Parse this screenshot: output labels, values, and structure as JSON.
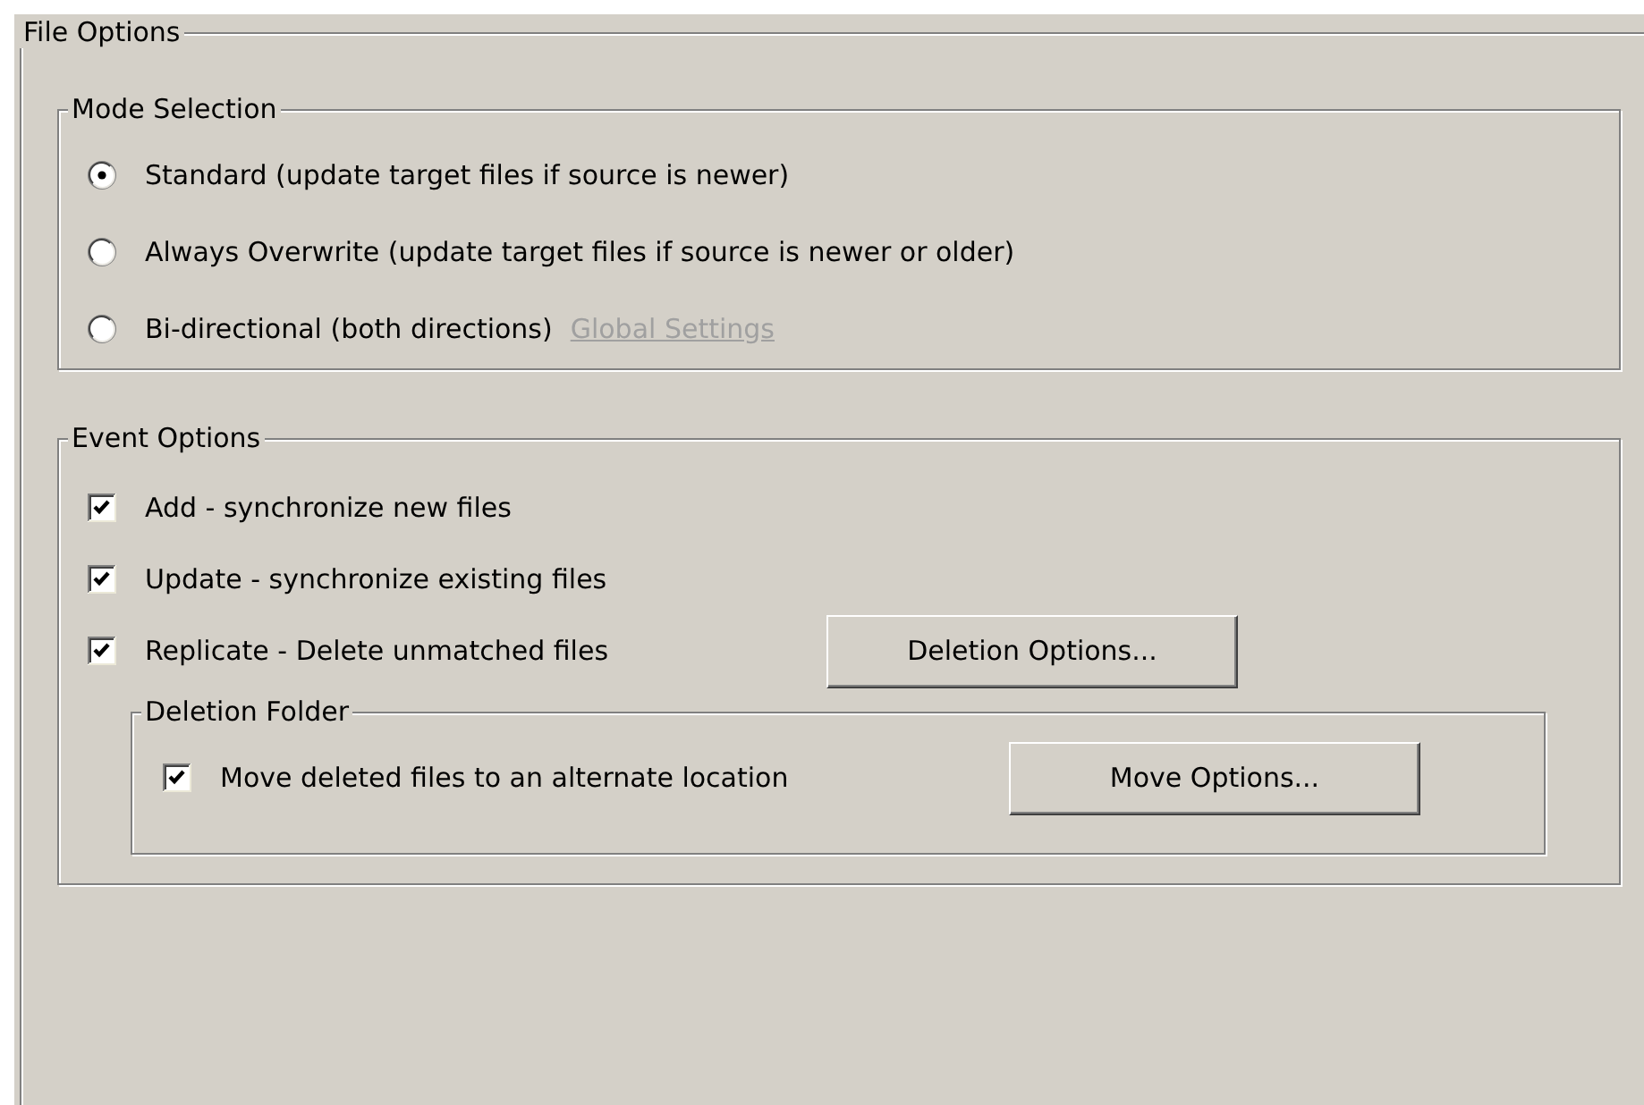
{
  "file_options": {
    "title": "File Options",
    "mode_selection": {
      "title": "Mode Selection",
      "options": [
        {
          "label": "Standard (update target files if source is newer)",
          "selected": true
        },
        {
          "label": "Always Overwrite (update target files if source is newer or older)",
          "selected": false
        },
        {
          "label": "Bi-directional (both directions)",
          "selected": false,
          "link": {
            "label": "Global Settings",
            "disabled": true
          }
        }
      ]
    },
    "event_options": {
      "title": "Event Options",
      "items": [
        {
          "label": "Add - synchronize new files",
          "checked": true
        },
        {
          "label": "Update - synchronize existing files",
          "checked": true
        },
        {
          "label": "Replicate - Delete unmatched files",
          "checked": true,
          "button": "Deletion Options..."
        }
      ],
      "deletion_folder": {
        "title": "Deletion Folder",
        "items": [
          {
            "label": "Move deleted files to an alternate location",
            "checked": true,
            "button": "Move Options..."
          }
        ]
      }
    }
  }
}
